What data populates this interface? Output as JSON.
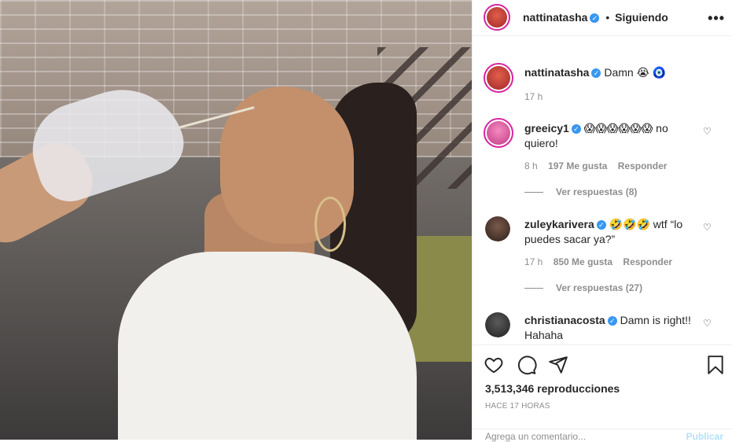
{
  "post": {
    "author": "nattinatasha",
    "follow_state": "Siguiendo",
    "more_label": "•••",
    "caption": {
      "username": "nattinatasha",
      "text": "Damn 😭 🧿",
      "time": "17 h"
    },
    "comments": [
      {
        "username": "greeicy1",
        "text": "😱😱😱😱😱😱 no quiero!",
        "time": "8 h",
        "likes": "197 Me gusta",
        "reply_label": "Responder",
        "view_replies": "Ver respuestas (8)"
      },
      {
        "username": "zuleykarivera",
        "text": "🤣🤣🤣 wtf “lo puedes sacar ya?”",
        "time": "17 h",
        "likes": "850 Me gusta",
        "reply_label": "Responder",
        "view_replies": "Ver respuestas (27)"
      },
      {
        "username": "christianacosta",
        "text": "Damn is right!! Hahaha"
      }
    ],
    "views": "3,513,346 reproducciones",
    "posted_ago": "HACE 17 HORAS",
    "composer": {
      "placeholder": "Agrega un comentario...",
      "publish": "Publicar"
    },
    "icons": [
      "heart-icon",
      "comment-icon",
      "share-icon",
      "bookmark-icon",
      "verified-icon",
      "heart-small-icon"
    ],
    "colors": {
      "verified": "#3897f0",
      "story_ring": "#d6249f",
      "muted": "#8e8e8e"
    }
  }
}
